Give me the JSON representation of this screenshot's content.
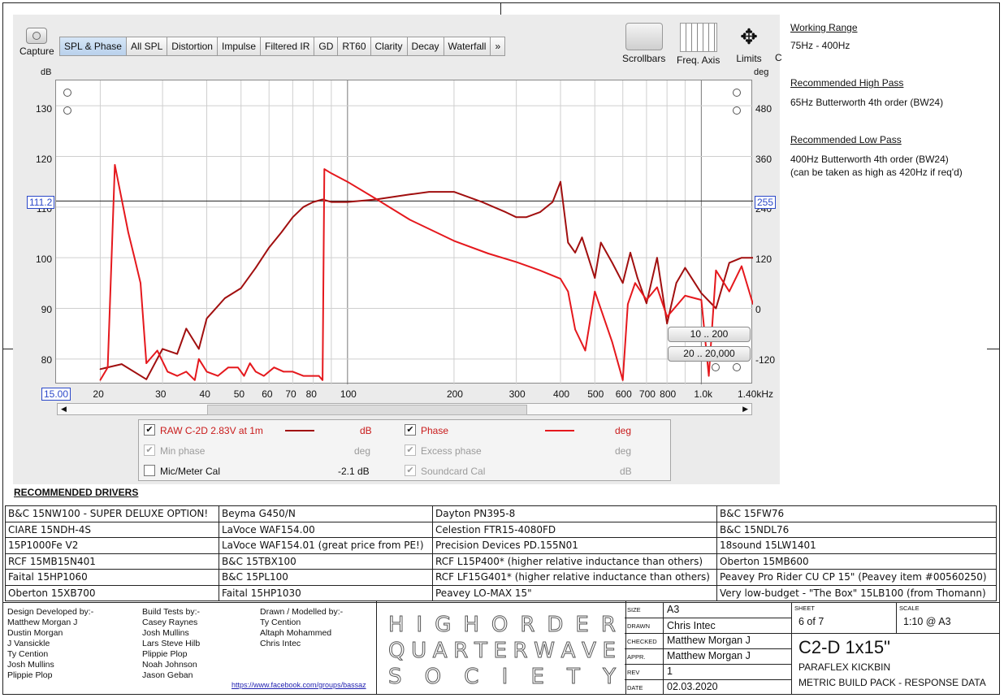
{
  "toolbar": {
    "capture_label": "Capture",
    "tabs": [
      "SPL & Phase",
      "All SPL",
      "Distortion",
      "Impulse",
      "Filtered IR",
      "GD",
      "RT60",
      "Clarity",
      "Decay",
      "Waterfall",
      "»"
    ],
    "active_tab": "SPL & Phase",
    "tools": [
      "Scrollbars",
      "Freq. Axis",
      "Limits"
    ],
    "cut_char": "C"
  },
  "chart": {
    "left_unit": "dB",
    "right_unit": "deg",
    "left_ticks": [
      "130",
      "120",
      "110",
      "100",
      "90",
      "80"
    ],
    "right_ticks": [
      "480",
      "360",
      "240",
      "120",
      "0",
      "-120"
    ],
    "x_ticks": [
      "20",
      "30",
      "40",
      "50",
      "60",
      "70",
      "80",
      "100",
      "200",
      "300",
      "400",
      "500",
      "600",
      "700",
      "800",
      "1.0k",
      "1.40kHz"
    ],
    "x_start_badge": "15.00",
    "cursor_left": "111.2",
    "cursor_right": "255",
    "range_buttons": [
      "10 .. 200",
      "20 .. 20,000"
    ]
  },
  "legend": {
    "rows": [
      {
        "label": "RAW C-2D 2.83V at 1m",
        "unit": "dB",
        "checked": true,
        "style": "active"
      },
      {
        "label": "Phase",
        "unit": "deg",
        "checked": true,
        "style": "active"
      },
      {
        "label": "Min phase",
        "unit": "deg",
        "checked": true,
        "style": "disabled"
      },
      {
        "label": "Excess phase",
        "unit": "deg",
        "checked": true,
        "style": "disabled"
      },
      {
        "label": "Mic/Meter Cal",
        "unit": "-2.1 dB",
        "checked": false,
        "style": "normal"
      },
      {
        "label": "Soundcard Cal",
        "unit": "dB",
        "checked": true,
        "style": "disabled"
      }
    ],
    "line_color_spl": "#a10f0f",
    "line_color_phase": "#e5181d"
  },
  "notes": {
    "working_range_title": "Working Range",
    "working_range": "75Hz - 400Hz",
    "high_pass_title": "Recommended High Pass",
    "high_pass": "65Hz Butterworth 4th order (BW24)",
    "low_pass_title": "Recommended Low Pass",
    "low_pass": "400Hz Butterworth 4th order (BW24)",
    "low_pass_note": "(can be taken as high as 420Hz if req'd)"
  },
  "drivers": {
    "title": "RECOMMENDED DRIVERS",
    "rows": [
      [
        "B&C 15NW100 - SUPER DELUXE OPTION!",
        "Beyma G450/N",
        "Dayton PN395-8",
        "B&C 15FW76"
      ],
      [
        "CIARE 15NDH-4S",
        "LaVoce WAF154.00",
        "Celestion FTR15-4080FD",
        "B&C 15NDL76"
      ],
      [
        "15P1000Fe V2",
        "LaVoce WAF154.01 (great price from PE!)",
        "Precision Devices PD.155N01",
        "18sound 15LW1401"
      ],
      [
        "RCF 15MB15N401",
        "B&C 15TBX100",
        "RCF L15P400* (higher relative inductance than others)",
        "Oberton 15MB600"
      ],
      [
        "Faital 15HP1060",
        "B&C 15PL100",
        "RCF LF15G401* (higher relative inductance than others)",
        "Peavey Pro Rider CU CP 15\" (Peavey item #00560250)"
      ],
      [
        "Oberton 15XB700",
        "Faital 15HP1030",
        "Peavey LO-MAX 15\"",
        "Very low-budget - \"The Box\" 15LB100 (from Thomann)"
      ]
    ]
  },
  "credits": {
    "design_title": "Design Developed by:-",
    "design": [
      "Matthew Morgan J",
      "Dustin Morgan",
      "J Vansickle",
      "Ty Cention",
      "Josh Mullins",
      "Plippie Plop"
    ],
    "tests_title": "Build Tests by:-",
    "tests": [
      "Casey Raynes",
      "Josh Mullins",
      "Lars Steve Hilb",
      "Plippie Plop",
      "Noah Johnson",
      "Jason Geban"
    ],
    "drawn_title": "Drawn / Modelled by:-",
    "drawn": [
      "Ty Cention",
      "Altaph Mohammed",
      "Chris Intec"
    ],
    "link": "https://www.facebook.com/groups/bassaz"
  },
  "logo": {
    "lines": [
      "HIGH ORDER",
      "QUARTERWAVE",
      "SOCIETY"
    ]
  },
  "titleblock": {
    "size_k": "SIZE",
    "size": "A3",
    "drawn_k": "DRAWN",
    "drawn": "Chris Intec",
    "checked_k": "CHECKED",
    "checked": "Matthew Morgan J",
    "appr_k": "APPR.",
    "appr": "Matthew Morgan J",
    "rev_k": "REV",
    "rev": "1",
    "date_k": "DATE",
    "date": "02.03.2020",
    "sheet_k": "SHEET",
    "sheet": "6 of 7",
    "scale_k": "SCALE",
    "scale": "1:10 @ A3",
    "model": "C2-D 1x15\"",
    "sub1": "PARAFLEX KICKBIN",
    "sub2": "METRIC BUILD PACK - RESPONSE DATA"
  },
  "chart_data": {
    "type": "line",
    "x_scale": "log",
    "xlim": [
      15,
      1400
    ],
    "ylim_left": [
      75,
      135
    ],
    "ylim_right": [
      -180,
      540
    ],
    "xlabel": "",
    "left_ylabel": "dB",
    "right_ylabel": "deg",
    "grid": true,
    "series": [
      {
        "name": "RAW C-2D 2.83V at 1m",
        "axis": "left",
        "color": "#a10f0f",
        "x": [
          20,
          23,
          27,
          30,
          33,
          35,
          38,
          40,
          45,
          50,
          55,
          60,
          65,
          70,
          75,
          80,
          85,
          90,
          100,
          120,
          150,
          170,
          200,
          240,
          280,
          300,
          320,
          350,
          380,
          400,
          420,
          440,
          460,
          500,
          520,
          560,
          600,
          630,
          660,
          700,
          750,
          800,
          850,
          900,
          1000,
          1100,
          1200,
          1300,
          1400
        ],
        "y": [
          78,
          79,
          76,
          82,
          81,
          86,
          82,
          88,
          92,
          94,
          98,
          102,
          105,
          108,
          110,
          111,
          111.5,
          111,
          111,
          111.5,
          112.5,
          113,
          113,
          111,
          109,
          108,
          108,
          109,
          111,
          115,
          103,
          101,
          104,
          96,
          103,
          99,
          95,
          101,
          96,
          91,
          100,
          87,
          95,
          98,
          93,
          90,
          99,
          100,
          100
        ]
      },
      {
        "name": "Phase",
        "axis": "right",
        "color": "#e5181d",
        "x": [
          20,
          21,
          22,
          24,
          25,
          26,
          27,
          29,
          31,
          33,
          35,
          37,
          38,
          40,
          43,
          46,
          49,
          51,
          53,
          55,
          58,
          62,
          66,
          70,
          75,
          80,
          83,
          85,
          86,
          90,
          100,
          120,
          150,
          200,
          250,
          300,
          350,
          400,
          420,
          440,
          470,
          500,
          560,
          600,
          620,
          650,
          700,
          750,
          800,
          900,
          1000,
          1050,
          1100,
          1200,
          1300,
          1400
        ],
        "y": [
          -170,
          -140,
          340,
          180,
          120,
          60,
          -130,
          -100,
          -150,
          -160,
          -150,
          -170,
          -120,
          -150,
          -160,
          -140,
          -140,
          -160,
          -130,
          -150,
          -160,
          -140,
          -150,
          -150,
          -160,
          -160,
          -160,
          -170,
          330,
          320,
          300,
          260,
          210,
          160,
          130,
          110,
          90,
          70,
          40,
          -50,
          -100,
          40,
          -80,
          -170,
          10,
          60,
          20,
          50,
          -20,
          30,
          20,
          -160,
          90,
          40,
          100,
          10
        ]
      }
    ]
  }
}
